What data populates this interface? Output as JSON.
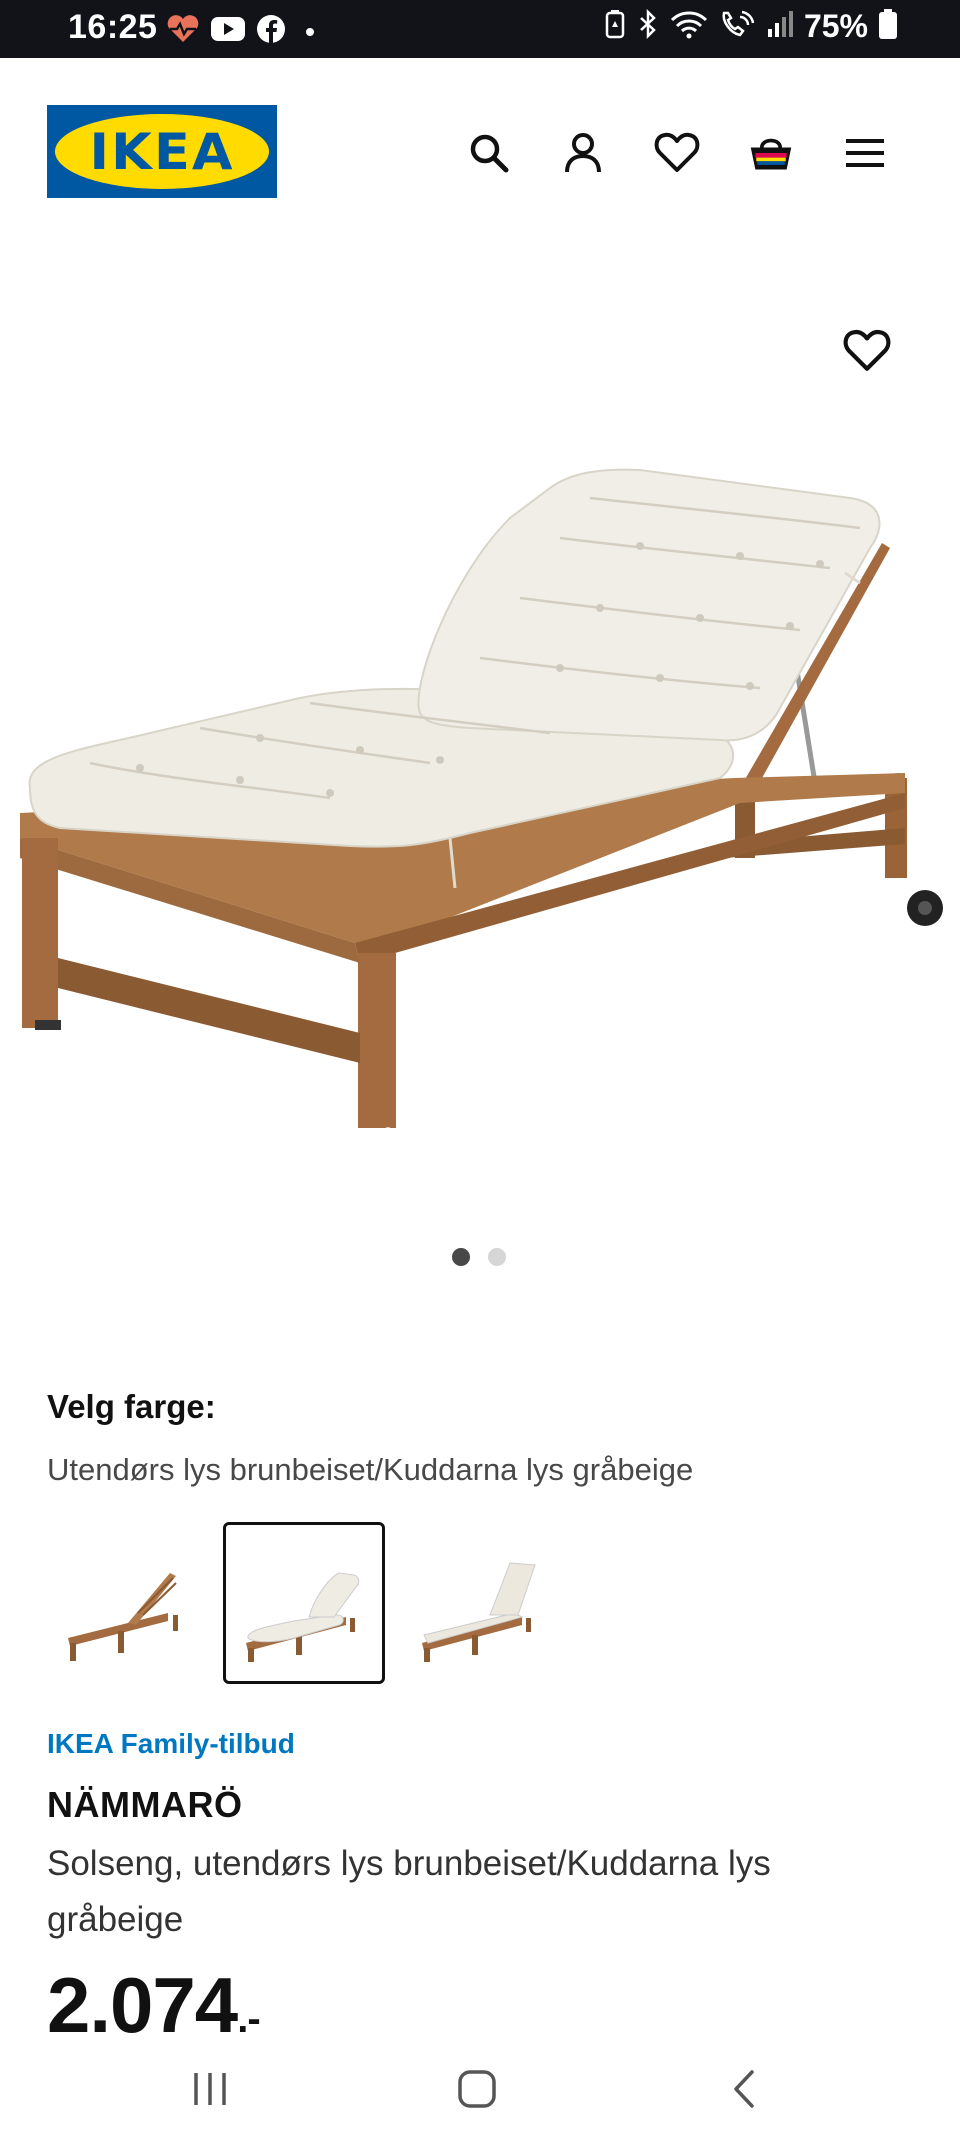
{
  "status_bar": {
    "time": "16:25",
    "battery_text": "75%",
    "left_icons": [
      "heart-pulse-icon",
      "youtube-icon",
      "facebook-icon"
    ],
    "right_icons": [
      "battery-saver-icon",
      "bluetooth-icon",
      "wifi-icon",
      "wifi-calling-icon",
      "signal-icon",
      "battery-icon"
    ]
  },
  "header": {
    "logo_text": "IKEA",
    "icons": [
      "search-icon",
      "user-icon",
      "heart-icon",
      "basket-icon",
      "menu-icon"
    ]
  },
  "gallery": {
    "image": "sun-lounger-with-cushion",
    "pages": 2,
    "active_page": 1
  },
  "color_picker": {
    "label": "Velg farge:",
    "selected_value": "Utendørs lys brunbeiset/Kuddarna lys gråbeige",
    "options": [
      "lounger-no-cushion",
      "lounger-tufted-cushion",
      "lounger-flat-cushion"
    ],
    "selected_index": 1
  },
  "product": {
    "offer_label": "IKEA Family-tilbud",
    "name": "NÄMMARÖ",
    "description": "Solseng, utendørs lys brunbeiset/Kuddarna lys gråbeige",
    "price": "2.074",
    "price_suffix": ".-"
  },
  "navbar": {
    "buttons": [
      "recent-apps-icon",
      "home-icon",
      "back-icon"
    ]
  },
  "colors": {
    "ikea_blue": "#0058a3",
    "ikea_yellow": "#ffdb00",
    "family_blue": "#0077c1",
    "wood": "#a36b3f",
    "cushion": "#efece4"
  }
}
